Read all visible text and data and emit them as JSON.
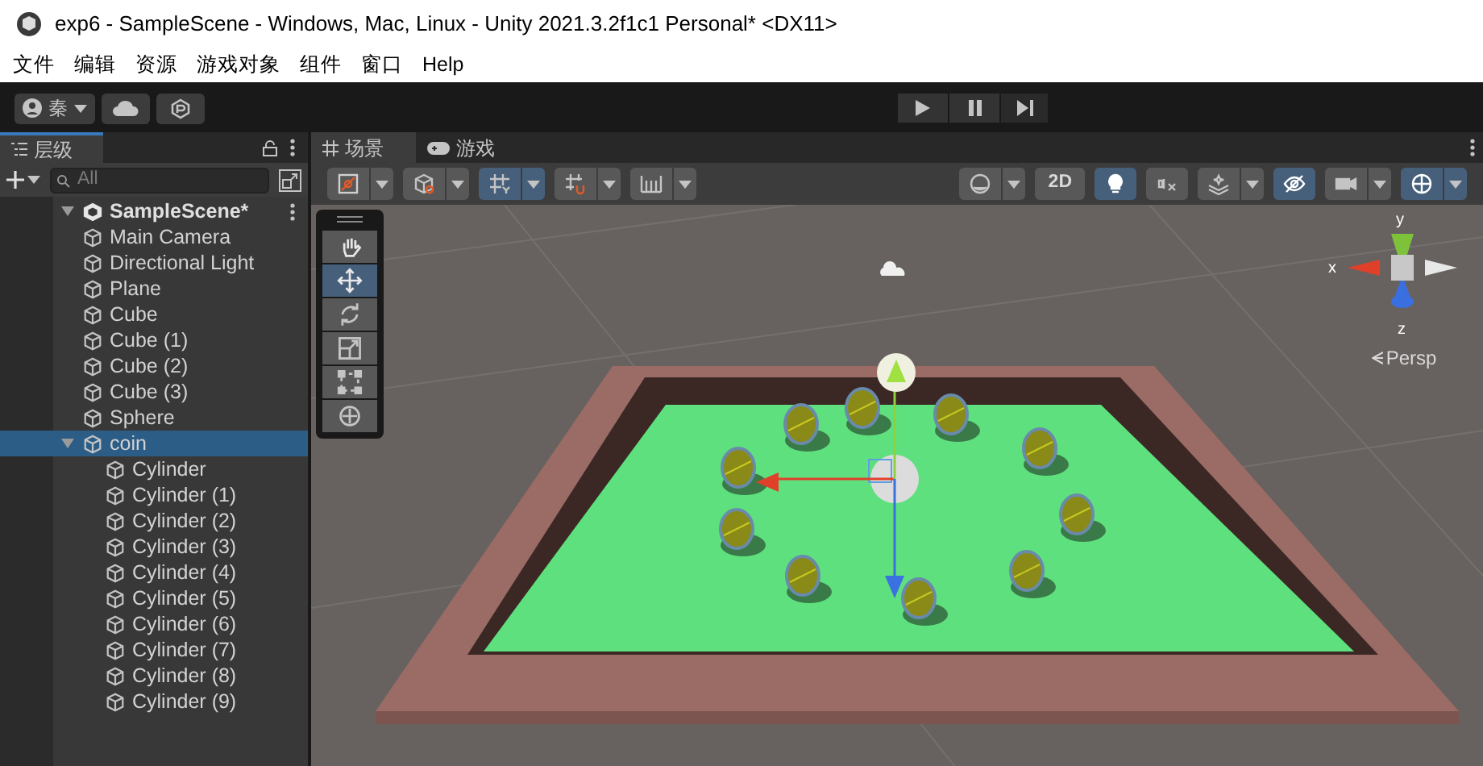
{
  "window": {
    "title": "exp6 - SampleScene - Windows, Mac, Linux - Unity 2021.3.2f1c1 Personal* <DX11>"
  },
  "menu_bar": [
    "文件",
    "编辑",
    "资源",
    "游戏对象",
    "组件",
    "窗口",
    "Help"
  ],
  "toolbar": {
    "account": "秦"
  },
  "hierarchy": {
    "tab": "层级",
    "search": {
      "placeholder": "All"
    },
    "tree": [
      {
        "label": "SampleScene*",
        "expanded": true,
        "selected": false,
        "children": [
          {
            "label": "Main Camera",
            "selected": false
          },
          {
            "label": "Directional Light",
            "selected": false
          },
          {
            "label": "Plane",
            "selected": false
          },
          {
            "label": "Cube",
            "selected": false
          },
          {
            "label": "Cube (1)",
            "selected": false
          },
          {
            "label": "Cube (2)",
            "selected": false
          },
          {
            "label": "Cube (3)",
            "selected": false
          },
          {
            "label": "Sphere",
            "selected": false
          },
          {
            "label": "coin",
            "expanded": true,
            "selected": true,
            "children": [
              {
                "label": "Cylinder",
                "selected": false
              },
              {
                "label": "Cylinder (1)",
                "selected": false
              },
              {
                "label": "Cylinder (2)",
                "selected": false
              },
              {
                "label": "Cylinder (3)",
                "selected": false
              },
              {
                "label": "Cylinder (4)",
                "selected": false
              },
              {
                "label": "Cylinder (5)",
                "selected": false
              },
              {
                "label": "Cylinder (6)",
                "selected": false
              },
              {
                "label": "Cylinder (7)",
                "selected": false
              },
              {
                "label": "Cylinder (8)",
                "selected": false
              },
              {
                "label": "Cylinder (9)",
                "selected": false
              }
            ]
          }
        ]
      }
    ]
  },
  "scene_tabs": [
    {
      "label": "场景",
      "selected": true
    },
    {
      "label": "游戏",
      "selected": false
    }
  ],
  "scene_toolbar": {
    "left": [
      {
        "on": false,
        "dropdown": true
      },
      {
        "on": false,
        "dropdown": true
      },
      {
        "on": true,
        "dropdown": true
      },
      {
        "on": false,
        "dropdown": true
      },
      {
        "on": false,
        "dropdown": true
      }
    ],
    "mode_2d": {
      "label": "2D",
      "on": false
    },
    "right": [
      {
        "on": false,
        "dropdown": true
      },
      {
        "on": true,
        "dropdown": false
      },
      {
        "on": false,
        "dropdown": false
      },
      {
        "on": false,
        "dropdown": true
      },
      {
        "on": true,
        "dropdown": false
      },
      {
        "on": false,
        "dropdown": true
      },
      {
        "on": true,
        "dropdown": true
      }
    ]
  },
  "tools": [
    {
      "selected": false
    },
    {
      "selected": true
    },
    {
      "selected": false
    },
    {
      "selected": false
    },
    {
      "selected": false
    },
    {
      "selected": false
    }
  ],
  "gizmo": {
    "y": "y",
    "x": "x",
    "z": "z",
    "projection": "Persp"
  }
}
